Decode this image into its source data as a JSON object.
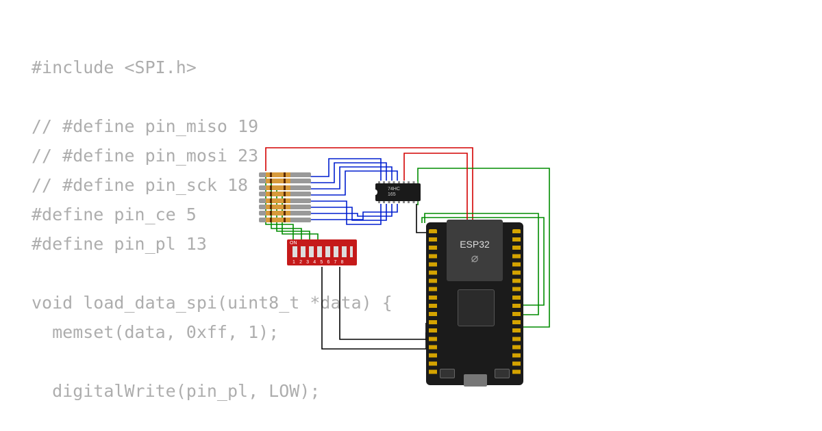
{
  "code_lines": [
    "#include <SPI.h>",
    "",
    "// #define pin_miso 19",
    "// #define pin_mosi 23",
    "// #define pin_sck 18",
    "#define pin_ce 5",
    "#define pin_pl 13",
    "",
    "void load_data_spi(uint8_t *data) {",
    "  memset(data, 0xff, 1);",
    "",
    "  digitalWrite(pin_pl, LOW);"
  ],
  "esp": {
    "label": "ESP32"
  },
  "ic": {
    "line1": "74HC",
    "line2": "165"
  },
  "dip": {
    "on": "ON",
    "numbers": "12345678"
  },
  "colors": {
    "red": "#d40000",
    "green": "#008c00",
    "blue": "#001ecf",
    "black": "#000"
  }
}
